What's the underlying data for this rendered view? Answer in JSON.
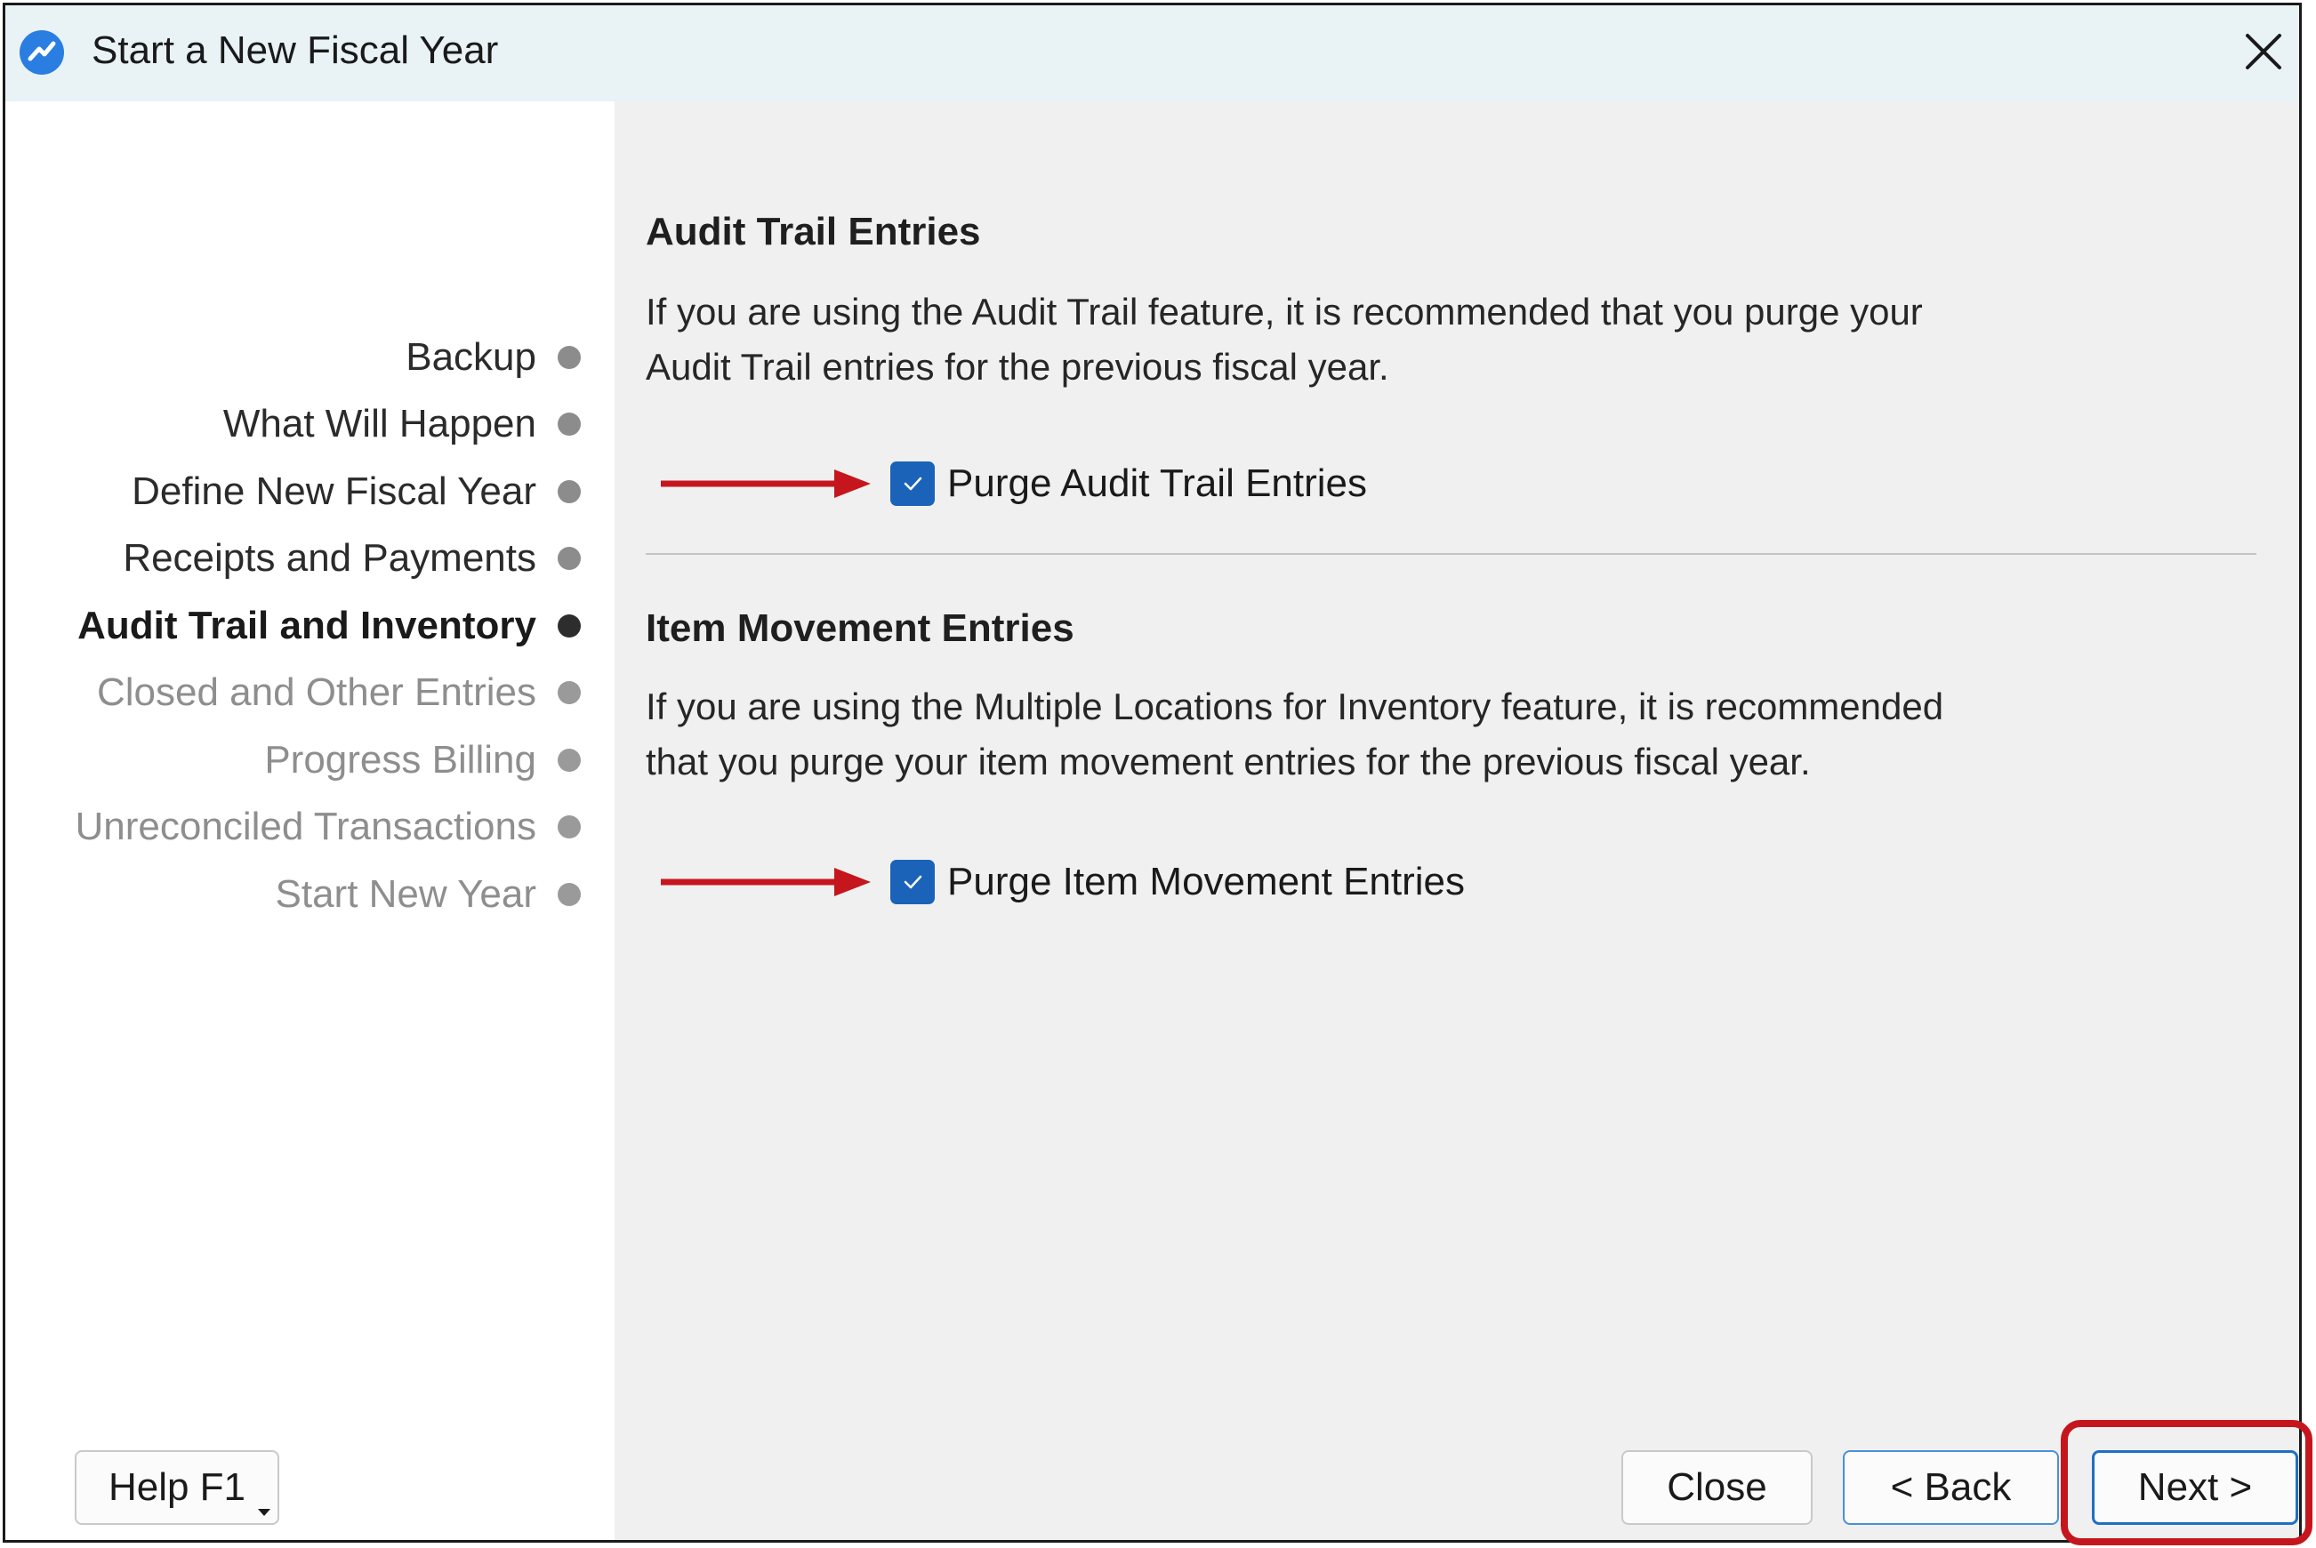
{
  "window": {
    "title": "Start a New Fiscal Year"
  },
  "sidebar": {
    "steps": [
      {
        "label": "Backup",
        "state": "done"
      },
      {
        "label": "What Will Happen",
        "state": "done"
      },
      {
        "label": "Define New Fiscal Year",
        "state": "done"
      },
      {
        "label": "Receipts and Payments",
        "state": "done"
      },
      {
        "label": "Audit Trail and Inventory",
        "state": "active"
      },
      {
        "label": "Closed and Other Entries",
        "state": "todo"
      },
      {
        "label": "Progress Billing",
        "state": "todo"
      },
      {
        "label": "Unreconciled Transactions",
        "state": "todo"
      },
      {
        "label": "Start New Year",
        "state": "todo"
      }
    ]
  },
  "audit": {
    "heading": "Audit Trail Entries",
    "line1": "If you are using the Audit Trail feature, it is recommended that you purge your",
    "line2": "Audit Trail entries for the previous fiscal year.",
    "checkbox_label": "Purge Audit Trail Entries",
    "checked": true
  },
  "item": {
    "heading": "Item Movement Entries",
    "line1": "If you are using the Multiple Locations for Inventory feature, it is recommended",
    "line2": "that you purge your item movement entries for the previous fiscal year.",
    "checkbox_label": "Purge Item Movement Entries",
    "checked": true
  },
  "buttons": {
    "help": "Help F1",
    "close": "Close",
    "back": "< Back",
    "next": "Next >"
  },
  "colors": {
    "accent": "#1a63b8",
    "annotation": "#c5161d",
    "titlebar": "#e9f3f6"
  },
  "icons": {
    "app": "app-logo-icon",
    "close": "close-icon",
    "check": "checkmark-icon",
    "arrow": "annotation-arrow-icon"
  }
}
